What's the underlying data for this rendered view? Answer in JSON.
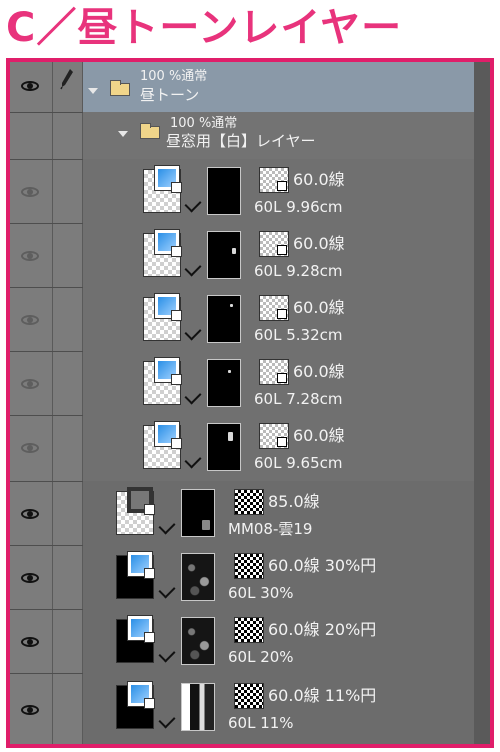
{
  "page_title": "C／昼トーンレイヤー",
  "folders": [
    {
      "opacity": "100 %通常",
      "name": "昼トーン"
    },
    {
      "opacity": "100 %通常",
      "name": "昼窓用【白】レイヤー"
    }
  ],
  "layers": [
    {
      "tone": "60.0線",
      "info": "60L 9.96cm"
    },
    {
      "tone": "60.0線",
      "info": "60L 9.28cm"
    },
    {
      "tone": "60.0線",
      "info": "60L 5.32cm"
    },
    {
      "tone": "60.0線",
      "info": "60L 7.28cm"
    },
    {
      "tone": "60.0線",
      "info": "60L 9.65cm"
    },
    {
      "tone": "85.0線",
      "info": "MM08-雲19"
    },
    {
      "tone": "60.0線 30%円",
      "info": "60L 30%"
    },
    {
      "tone": "60.0線 20%円",
      "info": "60L 20%"
    },
    {
      "tone": "60.0線 11%円",
      "info": "60L 11%"
    }
  ],
  "colors": {
    "title": "#e8337c",
    "frame_border": "#e01e6a",
    "panel_bg": "#707070",
    "folder_highlight": "#8a99a8"
  },
  "icons": {
    "eye": "eye-icon",
    "pen": "pen-icon",
    "folder": "folder-icon",
    "expand": "triangle-down-icon"
  }
}
